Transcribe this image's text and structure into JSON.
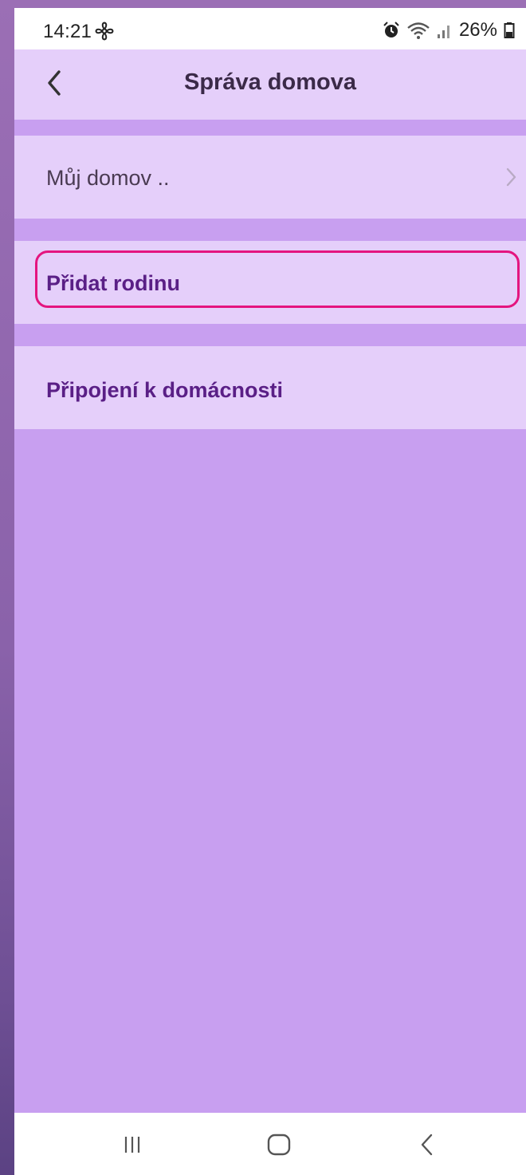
{
  "status_bar": {
    "time": "14:21",
    "battery": "26%",
    "icons": [
      "fan-icon",
      "alarm-icon",
      "wifi-icon",
      "signal-icon",
      "battery-icon"
    ]
  },
  "header": {
    "title": "Správa domova",
    "back_icon": "chevron-left-icon"
  },
  "menu": {
    "my_home": "Můj domov ..",
    "add_family": "Přidat rodinu",
    "join_household": "Připojení k domácnosti"
  },
  "nav_bar": {
    "icons": [
      "recents-icon",
      "home-icon",
      "back-icon"
    ]
  },
  "colors": {
    "background": "#c89ff0",
    "row": "#e5cffa",
    "accent_text": "#5a1f86",
    "highlight": "#e4157f"
  }
}
